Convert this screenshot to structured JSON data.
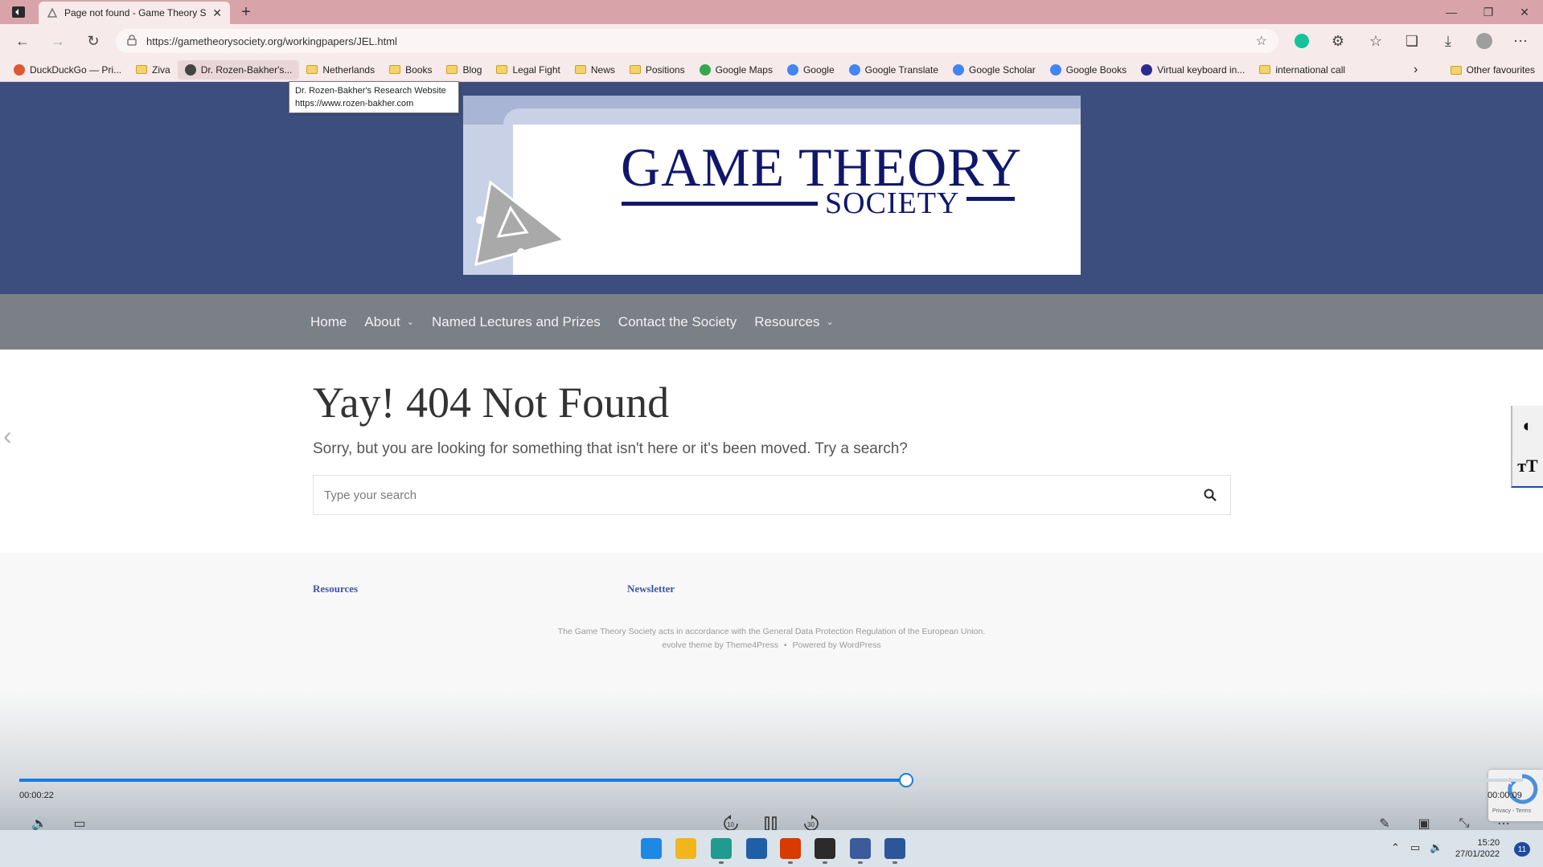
{
  "browser": {
    "tab_title": "Page not found - Game Theory S",
    "url": "https://gametheorysociety.org/workingpapers/JEL.html",
    "bookmarks": [
      {
        "label": "DuckDuckGo — Pri...",
        "icon": "duckduckgo-icon",
        "color": "#de5833"
      },
      {
        "label": "Ziva",
        "icon": "folder-icon"
      },
      {
        "label": "Dr. Rozen-Bakher's...",
        "icon": "cube-icon",
        "color": "#444444"
      },
      {
        "label": "Netherlands",
        "icon": "folder-icon"
      },
      {
        "label": "Books",
        "icon": "folder-icon"
      },
      {
        "label": "Blog",
        "icon": "folder-icon"
      },
      {
        "label": "Legal Fight",
        "icon": "folder-icon"
      },
      {
        "label": "News",
        "icon": "folder-icon"
      },
      {
        "label": "Positions",
        "icon": "folder-icon"
      },
      {
        "label": "Google Maps",
        "icon": "maps-pin-icon",
        "color": "#34a853"
      },
      {
        "label": "Google",
        "icon": "google-icon",
        "color": "#4285f4"
      },
      {
        "label": "Google Translate",
        "icon": "translate-icon",
        "color": "#4285f4"
      },
      {
        "label": "Google Scholar",
        "icon": "scholar-icon",
        "color": "#4285f4"
      },
      {
        "label": "Google Books",
        "icon": "google-icon",
        "color": "#4285f4"
      },
      {
        "label": "Virtual keyboard in...",
        "icon": "keyboard-icon",
        "color": "#2b2b8f"
      },
      {
        "label": "international call",
        "icon": "folder-icon"
      }
    ],
    "other_favourites": "Other favourites",
    "tooltip": {
      "title": "Dr. Rozen-Bakher's Research Website",
      "url": "https://www.rozen-bakher.com"
    }
  },
  "site": {
    "logo": {
      "title": "GAME THEORY",
      "subtitle": "SOCIETY"
    },
    "nav": [
      {
        "label": "Home",
        "has_dropdown": false
      },
      {
        "label": "About",
        "has_dropdown": true
      },
      {
        "label": "Named Lectures and Prizes",
        "has_dropdown": false
      },
      {
        "label": "Contact the Society",
        "has_dropdown": false
      },
      {
        "label": "Resources",
        "has_dropdown": true
      }
    ],
    "not_found": {
      "title": "Yay! 404 Not Found",
      "message": "Sorry, but you are looking for something that isn't here or it's been moved. Try a search?",
      "search_placeholder": "Type your search"
    },
    "footer": {
      "links": [
        "Resources",
        "Newsletter"
      ],
      "gdpr_note": "The Game Theory Society acts in accordance with the General Data Protection Regulation of the European Union.",
      "theme_credit": "evolve theme by Theme4Press",
      "separator": "•",
      "powered_by": "Powered by WordPress"
    },
    "recaptcha": "Privacy - Terms"
  },
  "video_player": {
    "elapsed": "00:00:22",
    "remaining": "00:00:09",
    "progress": 0.59,
    "skip_back": "10",
    "skip_forward": "30"
  },
  "taskbar": {
    "time": "15:20",
    "date": "27/01/2022",
    "notification_count": "11",
    "apps": [
      {
        "name": "windows-start-icon",
        "color": "#1e88e5"
      },
      {
        "name": "file-explorer-icon",
        "color": "#f2b51c"
      },
      {
        "name": "edge-icon",
        "color": "#1f9c8f"
      },
      {
        "name": "store-icon",
        "color": "#1f5fa8"
      },
      {
        "name": "office-icon",
        "color": "#d83b01"
      },
      {
        "name": "media-icon",
        "color": "#2b2b2b"
      },
      {
        "name": "remote-desktop-icon",
        "color": "#3b5b9a"
      },
      {
        "name": "word-icon",
        "color": "#2b579a"
      }
    ]
  },
  "colors": {
    "header_bg": "#3c4e7d",
    "nav_bg": "#7b7f86",
    "logo_text": "#10176b",
    "footer_link": "#3a55a5",
    "seek_accent": "#1b7ae0",
    "tab_strip": "#d9a4a9"
  }
}
